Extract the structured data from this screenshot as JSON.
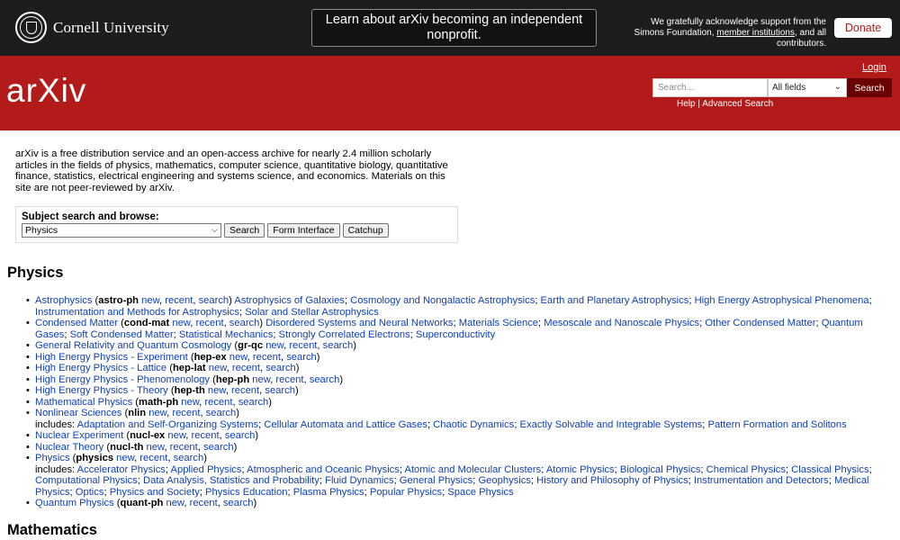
{
  "topbar": {
    "university": "Cornell University",
    "notice": "Learn about arXiv becoming an independent nonprofit.",
    "ack_pre": "We gratefully acknowledge support from the Simons Foundation, ",
    "ack_link": "member institutions",
    "ack_post": ", and all contributors.",
    "donate": "Donate"
  },
  "header": {
    "logo": "arXiv",
    "login": "Login",
    "search_placeholder": "Search...",
    "field_select": "All fields",
    "search_button": "Search",
    "help": "Help",
    "help_sep": " | ",
    "advanced": "Advanced Search"
  },
  "intro": "arXiv is a free distribution service and an open-access archive for nearly 2.4 million scholarly articles in the fields of physics, mathematics, computer science, quantitative biology, quantitative finance, statistics, electrical engineering and systems science, and economics. Materials on this site are not peer-reviewed by arXiv.",
  "subject": {
    "label": "Subject search and browse:",
    "selected": "Physics",
    "search": "Search",
    "form": "Form Interface",
    "catchup": "Catchup"
  },
  "sections": {
    "physics": "Physics",
    "math": "Mathematics"
  },
  "archives": [
    {
      "name": "Astrophysics",
      "code": "astro-ph",
      "prefix": "",
      "subs": [
        "Astrophysics of Galaxies",
        "Cosmology and Nongalactic Astrophysics",
        "Earth and Planetary Astrophysics",
        "High Energy Astrophysical Phenomena",
        "Instrumentation and Methods for Astrophysics",
        "Solar and Stellar Astrophysics"
      ]
    },
    {
      "name": "Condensed Matter",
      "code": "cond-mat",
      "prefix": "",
      "subs": [
        "Disordered Systems and Neural Networks",
        "Materials Science",
        "Mesoscale and Nanoscale Physics",
        "Other Condensed Matter",
        "Quantum Gases",
        "Soft Condensed Matter",
        "Statistical Mechanics",
        "Strongly Correlated Electrons",
        "Superconductivity"
      ]
    },
    {
      "name": "General Relativity and Quantum Cosmology",
      "code": "gr-qc",
      "prefix": "",
      "subs": []
    },
    {
      "name": "High Energy Physics - Experiment",
      "code": "hep-ex",
      "prefix": "",
      "subs": []
    },
    {
      "name": "High Energy Physics - Lattice",
      "code": "hep-lat",
      "prefix": "",
      "subs": []
    },
    {
      "name": "High Energy Physics - Phenomenology",
      "code": "hep-ph",
      "prefix": "",
      "subs": []
    },
    {
      "name": "High Energy Physics - Theory",
      "code": "hep-th",
      "prefix": "",
      "subs": []
    },
    {
      "name": "Mathematical Physics",
      "code": "math-ph",
      "prefix": "",
      "subs": []
    },
    {
      "name": "Nonlinear Sciences",
      "code": "nlin",
      "prefix": "includes: ",
      "subs": [
        "Adaptation and Self-Organizing Systems",
        "Cellular Automata and Lattice Gases",
        "Chaotic Dynamics",
        "Exactly Solvable and Integrable Systems",
        "Pattern Formation and Solitons"
      ]
    },
    {
      "name": "Nuclear Experiment",
      "code": "nucl-ex",
      "prefix": "",
      "subs": []
    },
    {
      "name": "Nuclear Theory",
      "code": "nucl-th",
      "prefix": "",
      "subs": []
    },
    {
      "name": "Physics",
      "code": "physics",
      "prefix": "includes: ",
      "subs": [
        "Accelerator Physics",
        "Applied Physics",
        "Atmospheric and Oceanic Physics",
        "Atomic and Molecular Clusters",
        "Atomic Physics",
        "Biological Physics",
        "Chemical Physics",
        "Classical Physics",
        "Computational Physics",
        "Data Analysis, Statistics and Probability",
        "Fluid Dynamics",
        "General Physics",
        "Geophysics",
        "History and Philosophy of Physics",
        "Instrumentation and Detectors",
        "Medical Physics",
        "Optics",
        "Physics and Society",
        "Physics Education",
        "Plasma Physics",
        "Popular Physics",
        "Space Physics"
      ]
    },
    {
      "name": "Quantum Physics",
      "code": "quant-ph",
      "prefix": "",
      "subs": []
    }
  ],
  "links": {
    "new": "new",
    "recent": "recent",
    "search": "search"
  }
}
